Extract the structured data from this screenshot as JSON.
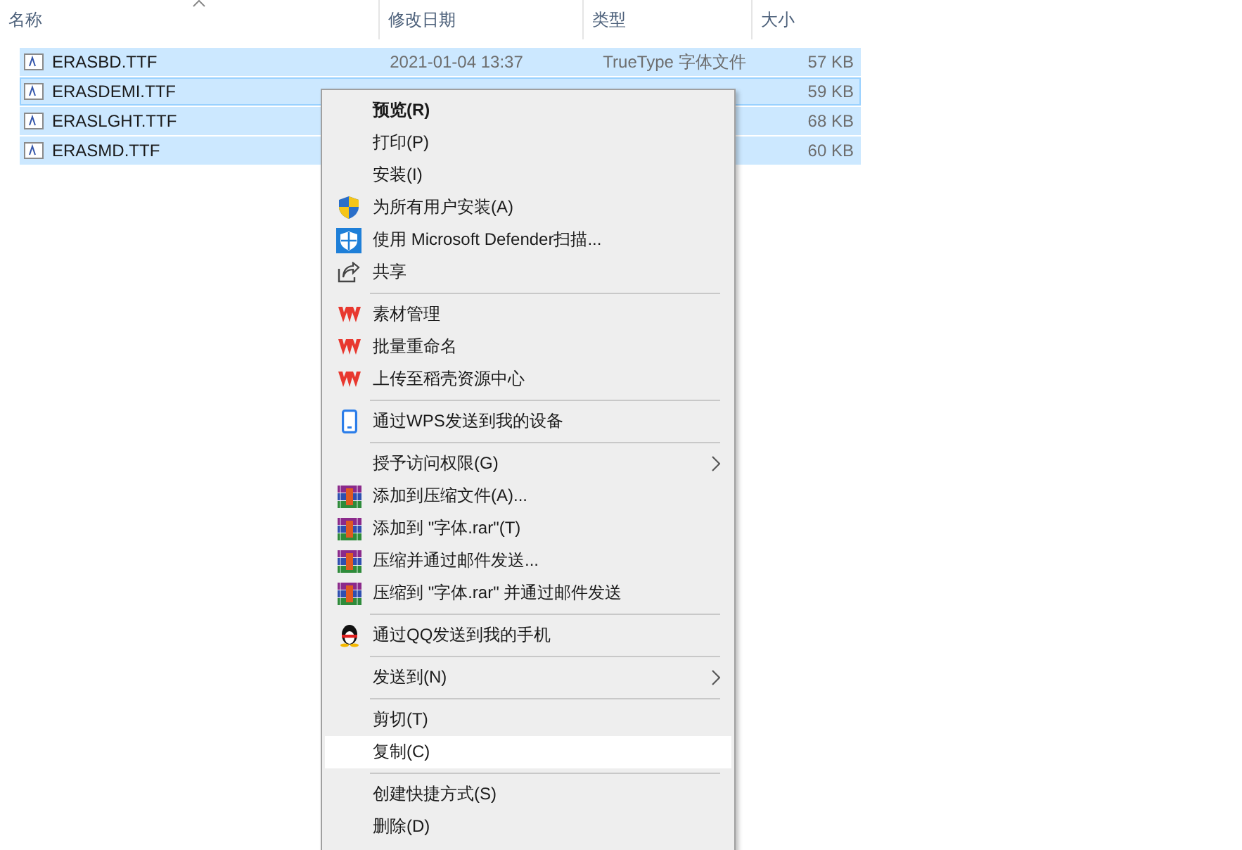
{
  "columns": [
    {
      "label": "名称",
      "sorted": true
    },
    {
      "label": "修改日期",
      "sorted": false
    },
    {
      "label": "类型",
      "sorted": false
    },
    {
      "label": "大小",
      "sorted": false
    }
  ],
  "files": [
    {
      "name": "ERASBD.TTF",
      "date": "2021-01-04 13:37",
      "type": "TrueType 字体文件",
      "size": "57 KB",
      "selected": true,
      "focused": false
    },
    {
      "name": "ERASDEMI.TTF",
      "size": "59 KB",
      "selected": true,
      "focused": true
    },
    {
      "name": "ERASLGHT.TTF",
      "size": "68 KB",
      "selected": true,
      "focused": false
    },
    {
      "name": "ERASMD.TTF",
      "size": "60 KB",
      "selected": true,
      "focused": false
    }
  ],
  "context_menu": [
    {
      "kind": "plain",
      "label": "预览(R)",
      "default": true,
      "submenu": false,
      "selected": false
    },
    {
      "kind": "plain",
      "label": "打印(P)",
      "default": false,
      "submenu": false,
      "selected": false
    },
    {
      "kind": "plain",
      "label": "安装(I)",
      "default": false,
      "submenu": false,
      "selected": false
    },
    {
      "kind": "shield",
      "label": "为所有用户安装(A)",
      "default": false,
      "submenu": false,
      "selected": false
    },
    {
      "kind": "defender",
      "label": "使用 Microsoft Defender扫描...",
      "default": false,
      "submenu": false,
      "selected": false
    },
    {
      "kind": "share",
      "label": "共享",
      "default": false,
      "submenu": false,
      "selected": false
    },
    {
      "kind": "separator"
    },
    {
      "kind": "wps",
      "label": "素材管理",
      "default": false,
      "submenu": false,
      "selected": false
    },
    {
      "kind": "wps",
      "label": "批量重命名",
      "default": false,
      "submenu": false,
      "selected": false
    },
    {
      "kind": "wps",
      "label": "上传至稻壳资源中心",
      "default": false,
      "submenu": false,
      "selected": false
    },
    {
      "kind": "separator"
    },
    {
      "kind": "phone",
      "label": "通过WPS发送到我的设备",
      "default": false,
      "submenu": false,
      "selected": false
    },
    {
      "kind": "separator"
    },
    {
      "kind": "plain",
      "label": "授予访问权限(G)",
      "default": false,
      "submenu": true,
      "selected": false
    },
    {
      "kind": "archive",
      "label": "添加到压缩文件(A)...",
      "default": false,
      "submenu": false,
      "selected": false
    },
    {
      "kind": "archive",
      "label": "添加到 \"字体.rar\"(T)",
      "default": false,
      "submenu": false,
      "selected": false
    },
    {
      "kind": "archive",
      "label": "压缩并通过邮件发送...",
      "default": false,
      "submenu": false,
      "selected": false
    },
    {
      "kind": "archive",
      "label": "压缩到 \"字体.rar\" 并通过邮件发送",
      "default": false,
      "submenu": false,
      "selected": false
    },
    {
      "kind": "separator"
    },
    {
      "kind": "penguin",
      "label": "通过QQ发送到我的手机",
      "default": false,
      "submenu": false,
      "selected": false
    },
    {
      "kind": "separator"
    },
    {
      "kind": "plain",
      "label": "发送到(N)",
      "default": false,
      "submenu": true,
      "selected": false
    },
    {
      "kind": "separator"
    },
    {
      "kind": "plain",
      "label": "剪切(T)",
      "default": false,
      "submenu": false,
      "selected": false
    },
    {
      "kind": "plain",
      "label": "复制(C)",
      "default": false,
      "submenu": false,
      "selected": true
    },
    {
      "kind": "separator"
    },
    {
      "kind": "plain",
      "label": "创建快捷方式(S)",
      "default": false,
      "submenu": false,
      "selected": false
    },
    {
      "kind": "plain",
      "label": "删除(D)",
      "default": false,
      "submenu": false,
      "selected": false
    }
  ]
}
